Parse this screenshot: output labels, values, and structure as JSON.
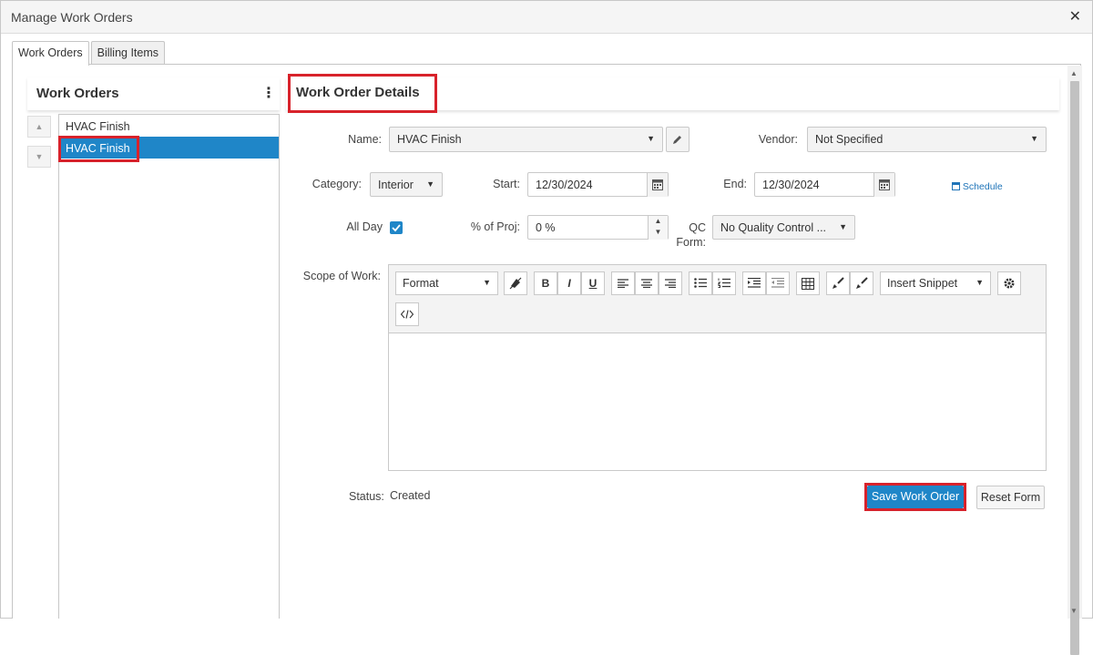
{
  "window": {
    "title": "Manage Work Orders",
    "close_glyph": "✕"
  },
  "tabs": [
    {
      "label": "Work Orders",
      "active": true
    },
    {
      "label": "Billing Items",
      "active": false
    }
  ],
  "work_orders": {
    "header": "Work Orders",
    "menu_glyph": "⋮",
    "move_up_glyph": "▲",
    "move_down_glyph": "▼",
    "items": [
      {
        "label": "HVAC Finish",
        "selected": false
      },
      {
        "label": "HVAC Finish",
        "selected": true
      }
    ]
  },
  "details": {
    "header": "Work Order Details",
    "name": {
      "label": "Name:",
      "value": "HVAC Finish"
    },
    "vendor": {
      "label": "Vendor:",
      "value": "Not Specified"
    },
    "category": {
      "label": "Category:",
      "value": "Interior"
    },
    "start": {
      "label": "Start:",
      "value": "12/30/2024"
    },
    "end": {
      "label": "End:",
      "value": "12/30/2024"
    },
    "schedule_link": "Schedule",
    "all_day": {
      "label": "All Day",
      "checked": true
    },
    "percent": {
      "label": "% of Proj:",
      "value": "0 %"
    },
    "qc_form": {
      "label_line1": "QC",
      "label_line2": "Form:",
      "value": "No Quality Control ..."
    },
    "scope": {
      "label": "Scope of Work:"
    },
    "status": {
      "label": "Status:",
      "value": "Created"
    }
  },
  "editor_toolbar": {
    "format_label": "Format",
    "snippet_label": "Insert Snippet",
    "bold": "B",
    "italic": "I",
    "underline": "U"
  },
  "actions": {
    "save": "Save Work Order",
    "reset": "Reset Form"
  },
  "colors": {
    "accent": "#1f86c8",
    "highlight": "#d8222b"
  }
}
